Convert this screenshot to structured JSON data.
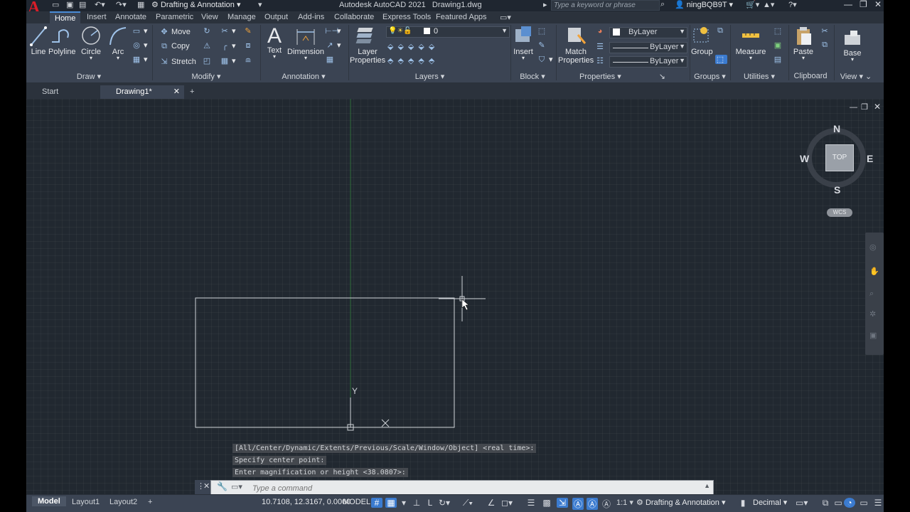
{
  "window": {
    "app_title": "Autodesk AutoCAD 2021",
    "file_title": "Drawing1.dwg",
    "workspace": "Drafting & Annotation",
    "search_placeholder": "Type a keyword or phrase",
    "user": "ningBQB9T"
  },
  "ribbon_tabs": [
    "Home",
    "Insert",
    "Annotate",
    "Parametric",
    "View",
    "Manage",
    "Output",
    "Add-ins",
    "Collaborate",
    "Express Tools",
    "Featured Apps"
  ],
  "ribbon": {
    "draw": {
      "title": "Draw",
      "line": "Line",
      "polyline": "Polyline",
      "circle": "Circle",
      "arc": "Arc"
    },
    "modify": {
      "title": "Modify",
      "move": "Move",
      "copy": "Copy",
      "stretch": "Stretch"
    },
    "annotation": {
      "title": "Annotation",
      "text": "Text",
      "dimension": "Dimension"
    },
    "layers": {
      "title": "Layers",
      "layer_properties_1": "Layer",
      "layer_properties_2": "Properties",
      "current_layer": "0"
    },
    "block": {
      "title": "Block",
      "insert": "Insert"
    },
    "properties": {
      "title": "Properties",
      "match_1": "Match",
      "match_2": "Properties",
      "color": "ByLayer",
      "linetype": "ByLayer",
      "lineweight": "ByLayer"
    },
    "groups": {
      "title": "Groups",
      "group": "Group"
    },
    "utilities": {
      "title": "Utilities",
      "measure": "Measure"
    },
    "clipboard": {
      "title": "Clipboard",
      "paste": "Paste"
    },
    "view": {
      "title": "View",
      "base": "Base"
    }
  },
  "file_tabs": [
    "Start",
    "Drawing1*"
  ],
  "viewcube": {
    "north": "N",
    "south": "S",
    "east": "E",
    "west": "W",
    "face": "TOP",
    "wcs": "WCS"
  },
  "ucs": {
    "x": "X",
    "y": "Y"
  },
  "command_history": [
    "[All/Center/Dynamic/Extents/Previous/Scale/Window/Object] <real time>:",
    "Specify center point:",
    "Enter magnification or height <38.0807>:"
  ],
  "command_placeholder": "Type a command",
  "status": {
    "layout_tabs": [
      "Model",
      "Layout1",
      "Layout2"
    ],
    "coordinates": "10.7108, 12.3167, 0.0000",
    "space": "MODEL",
    "scale": "1:1",
    "workspace": "Drafting & Annotation",
    "units": "Decimal"
  },
  "colors": {
    "accent": "#3b7bd0",
    "ribbon": "#3b4453",
    "canvas": "#212830",
    "logo": "#d91d28"
  }
}
